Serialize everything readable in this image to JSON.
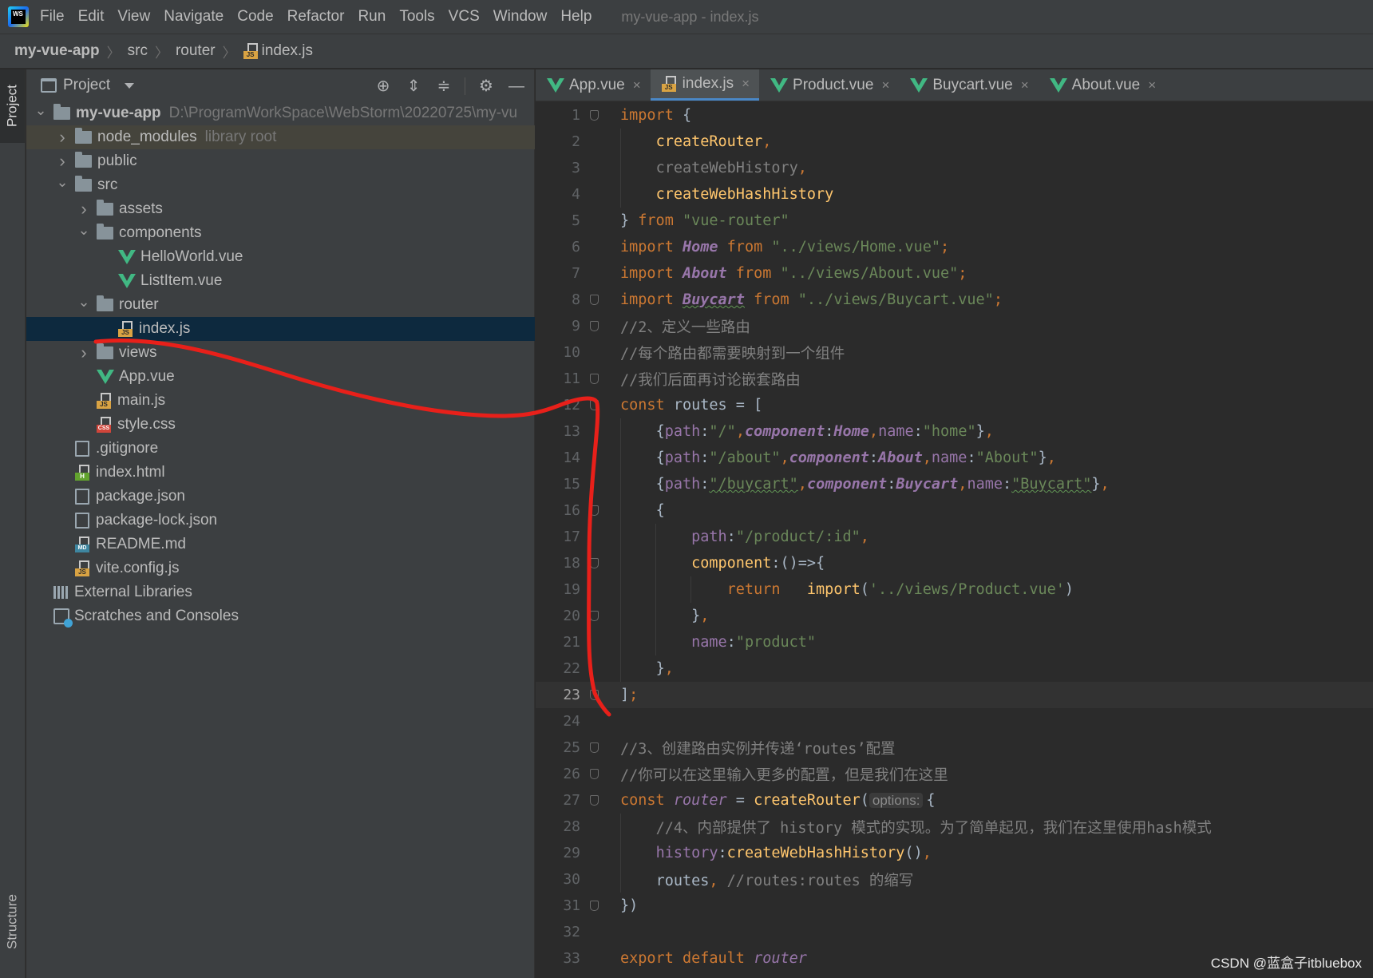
{
  "app": {
    "title": "my-vue-app - index.js",
    "menu": [
      "File",
      "Edit",
      "View",
      "Navigate",
      "Code",
      "Refactor",
      "Run",
      "Tools",
      "VCS",
      "Window",
      "Help"
    ]
  },
  "breadcrumb": [
    "my-vue-app",
    "src",
    "router",
    "index.js"
  ],
  "side_tabs": {
    "project": "Project",
    "structure": "Structure"
  },
  "project_panel": {
    "title": "Project",
    "tree": [
      {
        "label": "my-vue-app",
        "extra": "D:\\ProgramWorkSpace\\WebStorm\\20220725\\my-vu",
        "icon": "folder-icon",
        "depth": 0,
        "chevron": "down",
        "bold": true
      },
      {
        "label": "node_modules",
        "extra": "library root",
        "icon": "folder-icon",
        "depth": 1,
        "chevron": "right",
        "state": "highlight"
      },
      {
        "label": "public",
        "icon": "folder-icon",
        "depth": 1,
        "chevron": "right"
      },
      {
        "label": "src",
        "icon": "folder-icon",
        "depth": 1,
        "chevron": "down"
      },
      {
        "label": "assets",
        "icon": "folder-icon",
        "depth": 2,
        "chevron": "right"
      },
      {
        "label": "components",
        "icon": "folder-icon",
        "depth": 2,
        "chevron": "down"
      },
      {
        "label": "HelloWorld.vue",
        "icon": "vue-icon",
        "depth": 3
      },
      {
        "label": "ListItem.vue",
        "icon": "vue-icon",
        "depth": 3
      },
      {
        "label": "router",
        "icon": "folder-icon",
        "depth": 2,
        "chevron": "down"
      },
      {
        "label": "index.js",
        "icon": "js-file-icon",
        "depth": 3,
        "state": "selected"
      },
      {
        "label": "views",
        "icon": "folder-icon",
        "depth": 2,
        "chevron": "right"
      },
      {
        "label": "App.vue",
        "icon": "vue-icon",
        "depth": 2
      },
      {
        "label": "main.js",
        "icon": "js-file-icon",
        "depth": 2
      },
      {
        "label": "style.css",
        "icon": "css-file-icon",
        "depth": 2
      },
      {
        "label": ".gitignore",
        "icon": "gitignore-icon",
        "depth": 1
      },
      {
        "label": "index.html",
        "icon": "html-file-icon",
        "depth": 1
      },
      {
        "label": "package.json",
        "icon": "json-file-icon",
        "depth": 1
      },
      {
        "label": "package-lock.json",
        "icon": "json-file-icon",
        "depth": 1
      },
      {
        "label": "README.md",
        "icon": "md-file-icon",
        "depth": 1
      },
      {
        "label": "vite.config.js",
        "icon": "js-file-icon",
        "depth": 1
      },
      {
        "label": "External Libraries",
        "icon": "library-icon",
        "depth": 0
      },
      {
        "label": "Scratches and Consoles",
        "icon": "scratches-icon",
        "depth": 0
      }
    ]
  },
  "editor_tabs": [
    {
      "label": "App.vue",
      "icon": "vue-icon",
      "active": false
    },
    {
      "label": "index.js",
      "icon": "js-file-icon",
      "active": true
    },
    {
      "label": "Product.vue",
      "icon": "vue-icon",
      "active": false
    },
    {
      "label": "Buycart.vue",
      "icon": "vue-icon",
      "active": false
    },
    {
      "label": "About.vue",
      "icon": "vue-icon",
      "active": false
    }
  ],
  "code": {
    "current_line": 23,
    "lines": [
      {
        "n": 1,
        "fold": true,
        "tokens": [
          [
            "k",
            "import "
          ],
          [
            "w",
            "{"
          ]
        ]
      },
      {
        "n": 2,
        "indent": 1,
        "tokens": [
          [
            "f",
            "createRouter"
          ],
          [
            "k",
            ","
          ]
        ]
      },
      {
        "n": 3,
        "indent": 1,
        "tokens": [
          [
            "c",
            "createWebHistory"
          ],
          [
            "k",
            ","
          ]
        ]
      },
      {
        "n": 4,
        "indent": 1,
        "tokens": [
          [
            "f",
            "createWebHashHistory"
          ]
        ]
      },
      {
        "n": 5,
        "tokens": [
          [
            "w",
            "} "
          ],
          [
            "k",
            "from "
          ],
          [
            "s",
            "\"vue-router\""
          ]
        ]
      },
      {
        "n": 6,
        "tokens": [
          [
            "k",
            "import "
          ],
          [
            "pi",
            "Home"
          ],
          [
            "k",
            " from "
          ],
          [
            "s",
            "\"../views/Home.vue\""
          ],
          [
            "k",
            ";"
          ]
        ]
      },
      {
        "n": 7,
        "tokens": [
          [
            "k",
            "import "
          ],
          [
            "pi",
            "About"
          ],
          [
            "k",
            " from "
          ],
          [
            "s",
            "\"../views/About.vue\""
          ],
          [
            "k",
            ";"
          ]
        ]
      },
      {
        "n": 8,
        "fold": true,
        "tokens": [
          [
            "k",
            "import "
          ],
          [
            "piu",
            "Buycart"
          ],
          [
            "k",
            " from "
          ],
          [
            "s",
            "\"../views/Buycart.vue\""
          ],
          [
            "k",
            ";"
          ]
        ]
      },
      {
        "n": 9,
        "fold": true,
        "tokens": [
          [
            "c",
            "//2、定义一些路由"
          ]
        ]
      },
      {
        "n": 10,
        "tokens": [
          [
            "c",
            "//每个路由都需要映射到一个组件"
          ]
        ]
      },
      {
        "n": 11,
        "fold": true,
        "tokens": [
          [
            "c",
            "//我们后面再讨论嵌套路由"
          ]
        ]
      },
      {
        "n": 12,
        "fold": true,
        "tokens": [
          [
            "k",
            "const "
          ],
          [
            "w",
            "routes = ["
          ]
        ]
      },
      {
        "n": 13,
        "indent": 1,
        "tokens": [
          [
            "w",
            "{"
          ],
          [
            "p",
            "path"
          ],
          [
            "w",
            ":"
          ],
          [
            "s",
            "\"/\""
          ],
          [
            "k",
            ","
          ],
          [
            "pi",
            "component"
          ],
          [
            "w",
            ":"
          ],
          [
            "pi",
            "Home"
          ],
          [
            "k",
            ","
          ],
          [
            "p",
            "name"
          ],
          [
            "w",
            ":"
          ],
          [
            "s",
            "\"home\""
          ],
          [
            "w",
            "}"
          ],
          [
            "k",
            ","
          ]
        ]
      },
      {
        "n": 14,
        "indent": 1,
        "tokens": [
          [
            "w",
            "{"
          ],
          [
            "p",
            "path"
          ],
          [
            "w",
            ":"
          ],
          [
            "s",
            "\"/about\""
          ],
          [
            "k",
            ","
          ],
          [
            "pi",
            "component"
          ],
          [
            "w",
            ":"
          ],
          [
            "pi",
            "About"
          ],
          [
            "k",
            ","
          ],
          [
            "p",
            "name"
          ],
          [
            "w",
            ":"
          ],
          [
            "s",
            "\"About\""
          ],
          [
            "w",
            "}"
          ],
          [
            "k",
            ","
          ]
        ]
      },
      {
        "n": 15,
        "indent": 1,
        "tokens": [
          [
            "w",
            "{"
          ],
          [
            "p",
            "path"
          ],
          [
            "w",
            ":"
          ],
          [
            "su",
            "\"/buycart\""
          ],
          [
            "k",
            ","
          ],
          [
            "pi",
            "component"
          ],
          [
            "w",
            ":"
          ],
          [
            "pi",
            "Buycart"
          ],
          [
            "k",
            ","
          ],
          [
            "p",
            "name"
          ],
          [
            "w",
            ":"
          ],
          [
            "su",
            "\"Buycart\""
          ],
          [
            "w",
            "}"
          ],
          [
            "k",
            ","
          ]
        ]
      },
      {
        "n": 16,
        "indent": 1,
        "fold": true,
        "tokens": [
          [
            "w",
            "{"
          ]
        ]
      },
      {
        "n": 17,
        "indent": 2,
        "tokens": [
          [
            "p",
            "path"
          ],
          [
            "w",
            ":"
          ],
          [
            "s",
            "\"/product/:id\""
          ],
          [
            "k",
            ","
          ]
        ]
      },
      {
        "n": 18,
        "indent": 2,
        "fold": true,
        "tokens": [
          [
            "f",
            "component"
          ],
          [
            "w",
            ":()=>{"
          ]
        ]
      },
      {
        "n": 19,
        "indent": 3,
        "tokens": [
          [
            "k",
            "return   "
          ],
          [
            "f",
            "import"
          ],
          [
            "w",
            "("
          ],
          [
            "s",
            "'../views/Product.vue'"
          ],
          [
            "w",
            ")"
          ]
        ]
      },
      {
        "n": 20,
        "indent": 2,
        "fold": true,
        "tokens": [
          [
            "w",
            "}"
          ],
          [
            "k",
            ","
          ]
        ]
      },
      {
        "n": 21,
        "indent": 2,
        "tokens": [
          [
            "p",
            "name"
          ],
          [
            "w",
            ":"
          ],
          [
            "s",
            "\"product\""
          ]
        ]
      },
      {
        "n": 22,
        "indent": 1,
        "tokens": [
          [
            "w",
            "}"
          ],
          [
            "k",
            ","
          ]
        ]
      },
      {
        "n": 23,
        "fold": true,
        "tokens": [
          [
            "w",
            "]"
          ],
          [
            "k",
            ";"
          ]
        ]
      },
      {
        "n": 24,
        "tokens": []
      },
      {
        "n": 25,
        "fold": true,
        "tokens": [
          [
            "c",
            "//3、创建路由实例并传递‘routes’配置"
          ]
        ]
      },
      {
        "n": 26,
        "fold": true,
        "tokens": [
          [
            "c",
            "//你可以在这里输入更多的配置，但是我们在这里"
          ]
        ]
      },
      {
        "n": 27,
        "fold": true,
        "tokens": [
          [
            "k",
            "const "
          ],
          [
            "gi",
            "router"
          ],
          [
            "w",
            " = "
          ],
          [
            "f",
            "createRouter"
          ],
          [
            "w",
            "("
          ],
          [
            "hint",
            "options:"
          ],
          [
            "w",
            "{"
          ]
        ]
      },
      {
        "n": 28,
        "indent": 1,
        "tokens": [
          [
            "c",
            "//4、内部提供了 history 模式的实现。为了简单起见，我们在这里使用hash模式"
          ]
        ]
      },
      {
        "n": 29,
        "indent": 1,
        "tokens": [
          [
            "p",
            "history"
          ],
          [
            "w",
            ":"
          ],
          [
            "f",
            "createWebHashHistory"
          ],
          [
            "w",
            "()"
          ],
          [
            "k",
            ","
          ]
        ]
      },
      {
        "n": 30,
        "indent": 1,
        "tokens": [
          [
            "w",
            "routes"
          ],
          [
            "k",
            ", "
          ],
          [
            "c",
            "//routes:routes 的缩写"
          ]
        ]
      },
      {
        "n": 31,
        "fold": true,
        "tokens": [
          [
            "w",
            "})"
          ]
        ]
      },
      {
        "n": 32,
        "tokens": []
      },
      {
        "n": 33,
        "tokens": [
          [
            "k",
            "export default "
          ],
          [
            "gi",
            "router"
          ]
        ]
      }
    ]
  },
  "watermark": "CSDN @蓝盒子itbluebox",
  "annotation_color": "#e8201a"
}
